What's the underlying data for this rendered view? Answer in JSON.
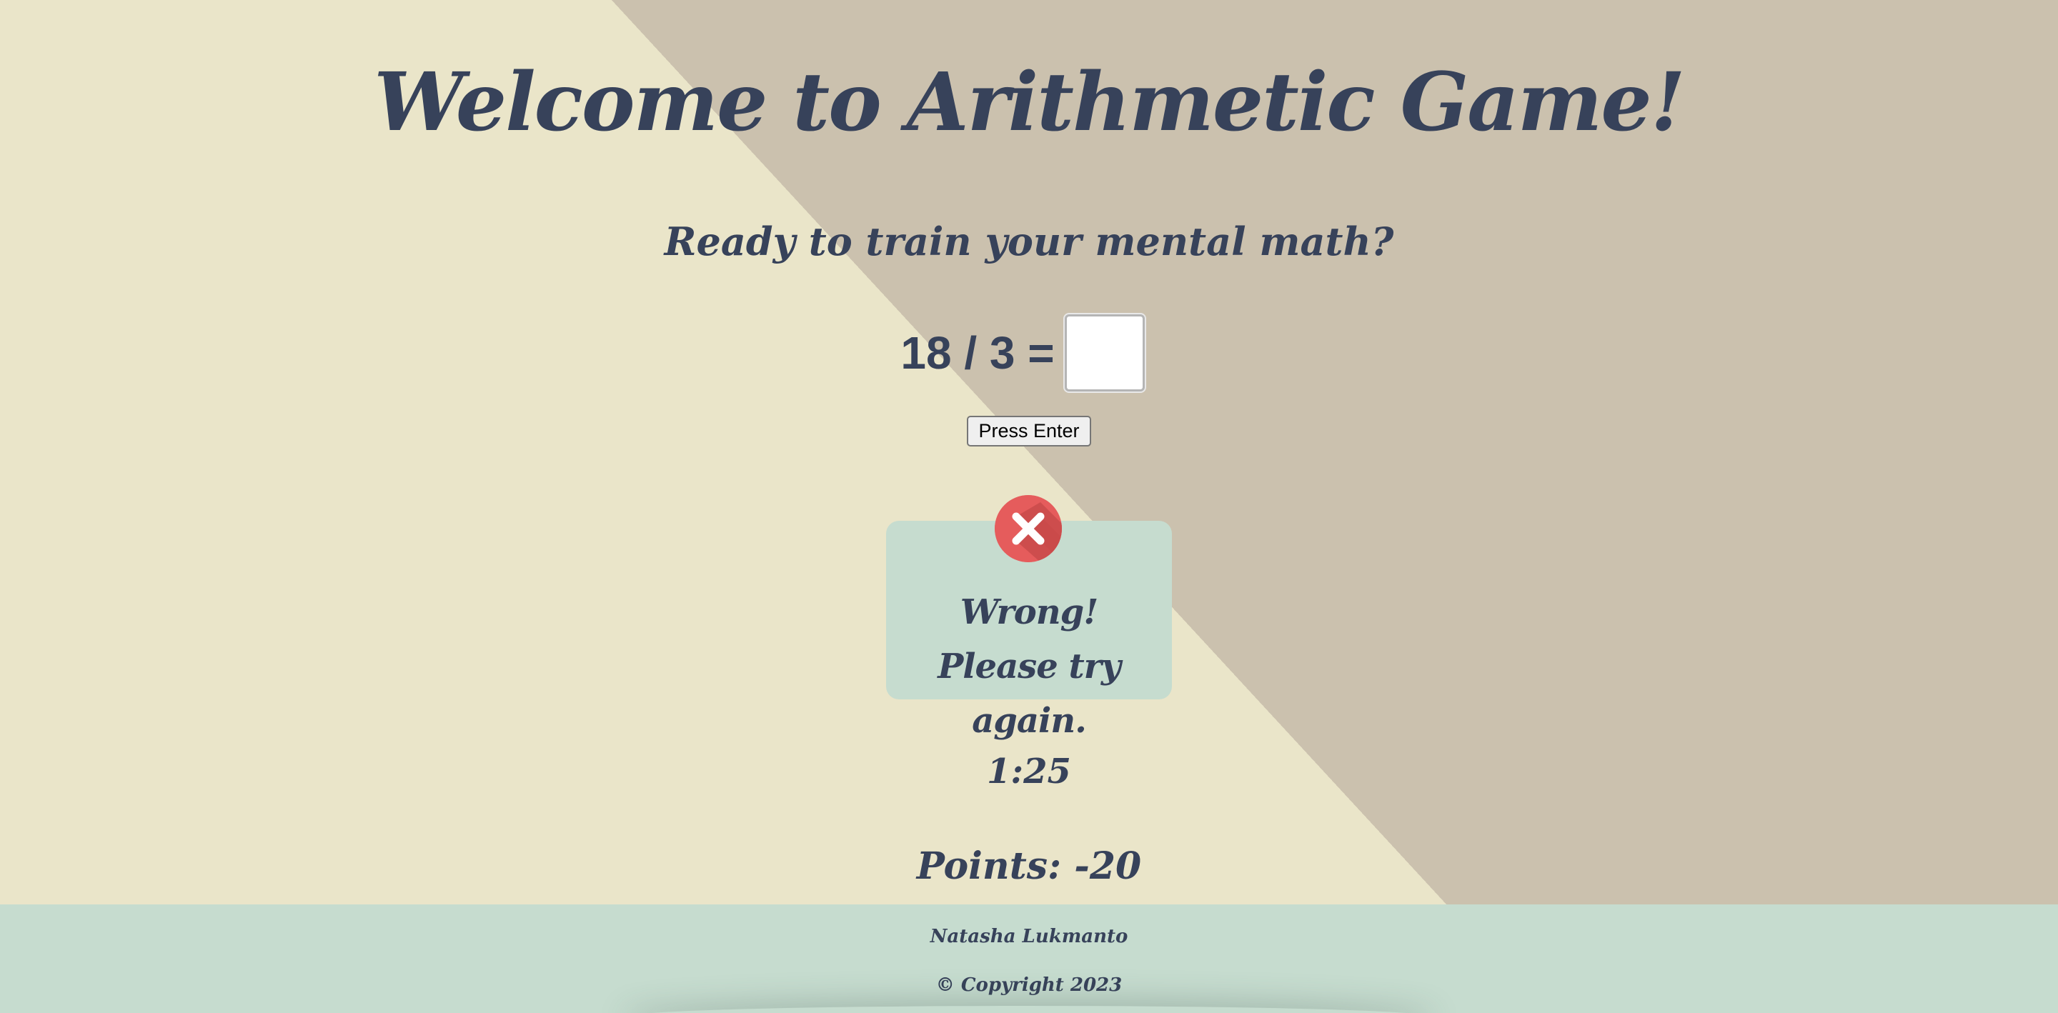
{
  "header": {
    "title": "Welcome to Arithmetic Game!",
    "subtitle": "Ready to train your mental math?"
  },
  "question": {
    "equation": "18 / 3 =",
    "answer_value": ""
  },
  "controls": {
    "enter_label": "Press Enter"
  },
  "feedback": {
    "status": "wrong",
    "icon": "cross-icon",
    "line1": "Wrong!",
    "line2": "Please try again."
  },
  "stats": {
    "timer": "1:25",
    "points": "Points: -20"
  },
  "footer": {
    "author": "Natasha Lukmanto",
    "copyright": "© Copyright 2023"
  },
  "colors": {
    "text": "#37425a",
    "background_light": "#eae5c9",
    "background_dark": "#cbc1ae",
    "card": "#c6dccf",
    "wrong_badge": "#e55c5c"
  }
}
